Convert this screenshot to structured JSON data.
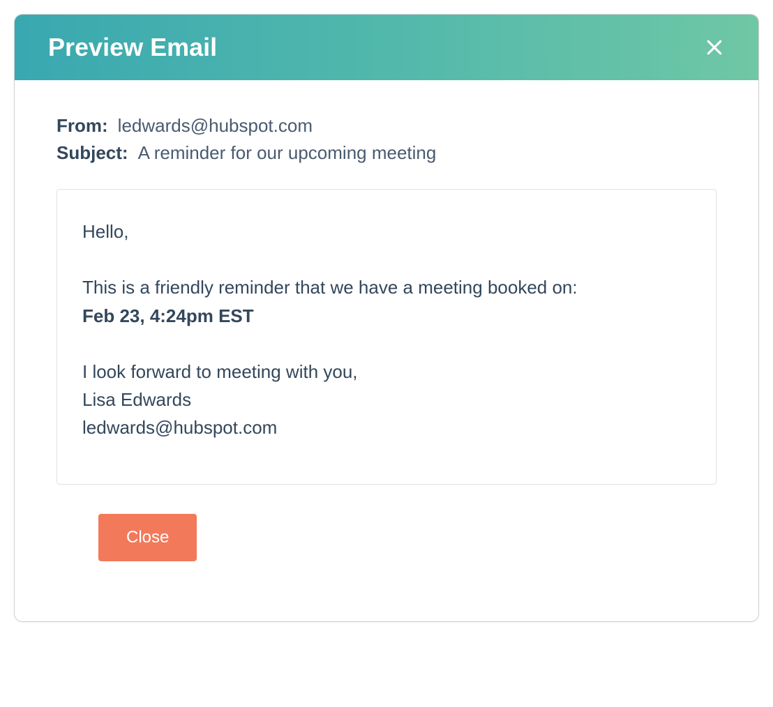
{
  "modal": {
    "title": "Preview Email",
    "from_label": "From:",
    "from_value": "ledwards@hubspot.com",
    "subject_label": "Subject:",
    "subject_value": "A reminder for our upcoming meeting",
    "body": {
      "greeting": "Hello,",
      "line1": "This is a friendly reminder that we have a meeting booked on:",
      "datetime": "Feb 23, 4:24pm EST",
      "closing": "I look forward to meeting with you,",
      "signature_name": "Lisa Edwards",
      "signature_email": "ledwards@hubspot.com"
    },
    "close_button": "Close"
  }
}
